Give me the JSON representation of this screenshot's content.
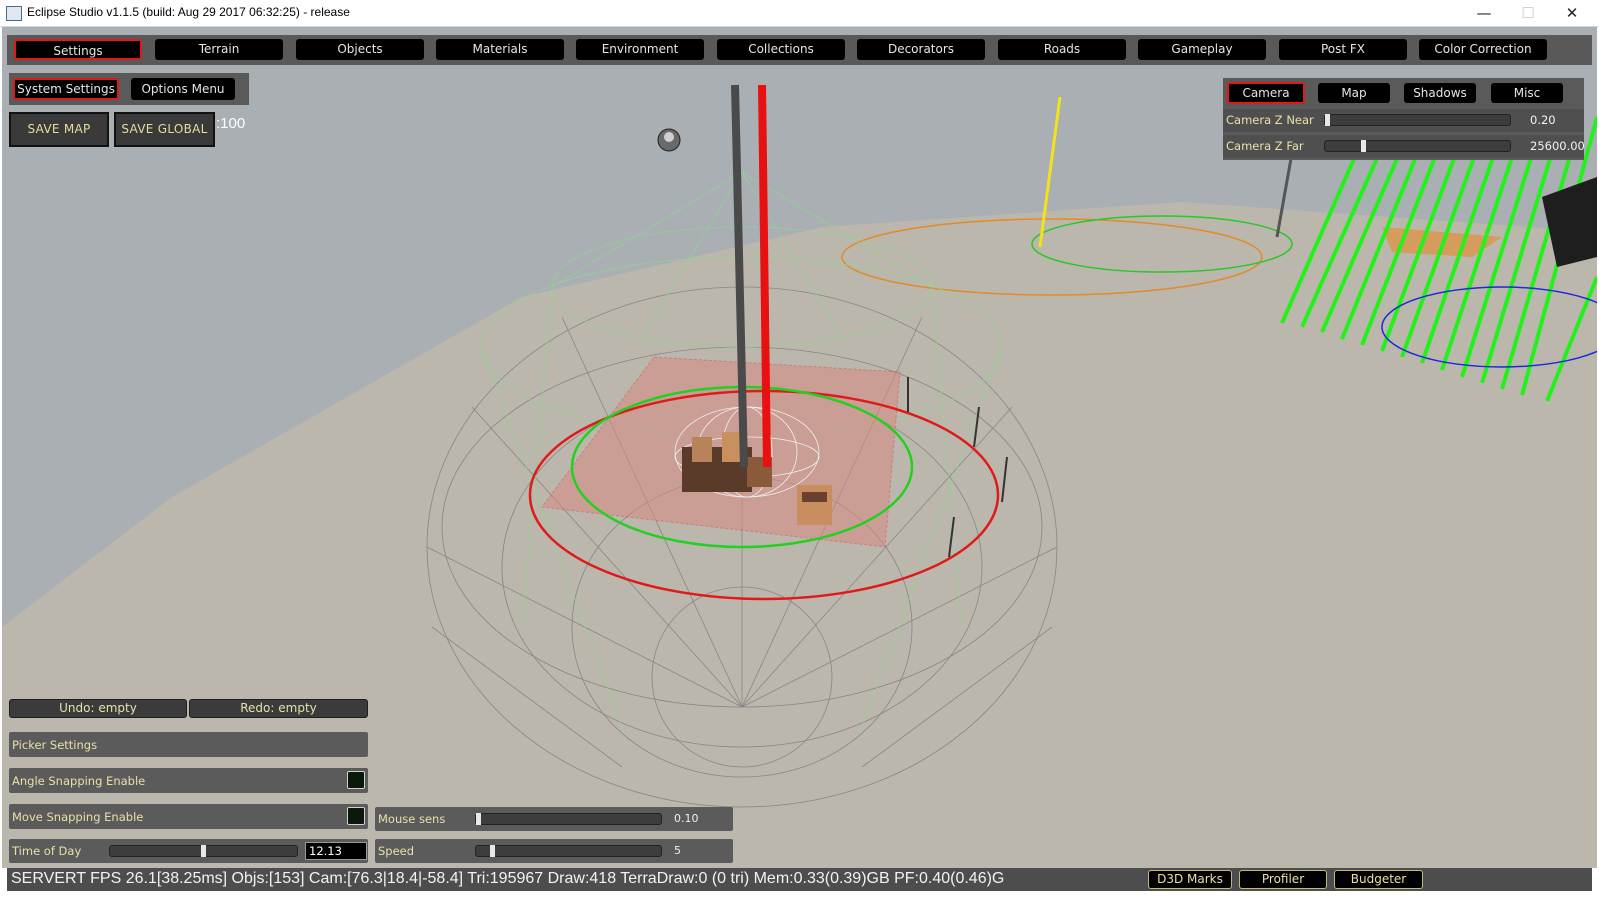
{
  "window": {
    "title": "Eclipse Studio v1.1.5  (build: Aug 29 2017 06:32:25) - release",
    "minimize_label": "—",
    "maximize_label": "☐",
    "close_label": "✕"
  },
  "top_menu": {
    "selected": "Settings",
    "items": [
      "Settings",
      "Terrain",
      "Objects",
      "Materials",
      "Environment",
      "Collections",
      "Decorators",
      "Roads",
      "Gameplay",
      "Post FX",
      "Color Correction"
    ]
  },
  "settings_tabs": {
    "system_settings": "System Settings",
    "options_menu": "Options Menu"
  },
  "save_buttons": {
    "save_map": "SAVE MAP",
    "save_global": "SAVE GLOBAL",
    "trailing_text": ":100"
  },
  "camera_panel": {
    "tabs": [
      "Camera",
      "Map",
      "Shadows",
      "Misc"
    ],
    "selected": "Camera",
    "near_label": "Camera Z Near",
    "near_value": "0.20",
    "near_fraction": 0.0,
    "far_label": "Camera Z Far",
    "far_value": "25600.00",
    "far_fraction": 0.2
  },
  "history": {
    "undo": "Undo: empty",
    "redo": "Redo: empty"
  },
  "picker": {
    "title": "Picker Settings",
    "angle_snapping": "Angle Snapping Enable",
    "move_snapping": "Move Snapping Enable",
    "time_of_day_label": "Time of Day",
    "time_of_day_value": "12.13",
    "time_of_day_fraction": 0.5
  },
  "mouse": {
    "sens_label": "Mouse sens",
    "sens_value": "0.10",
    "sens_fraction": 0.0,
    "speed_label": "Speed",
    "speed_value": "5",
    "speed_fraction": 0.08
  },
  "status": {
    "text": "SERVERT FPS 26.1[38.25ms] Objs:[153] Cam:[76.3|18.4|-58.4] Tri:195967 Draw:418 TerraDraw:0 (0 tri) Mem:0.33(0.39)GB PF:0.40(0.46)G",
    "buttons": [
      "D3D Marks",
      "Profiler",
      "Budgeter"
    ]
  },
  "colors": {
    "selected_border": "#e01818",
    "button_bg": "#000000",
    "label_text": "#e8e0a8",
    "sky": "#a8aeb2",
    "ground": "#bcb7ad"
  }
}
